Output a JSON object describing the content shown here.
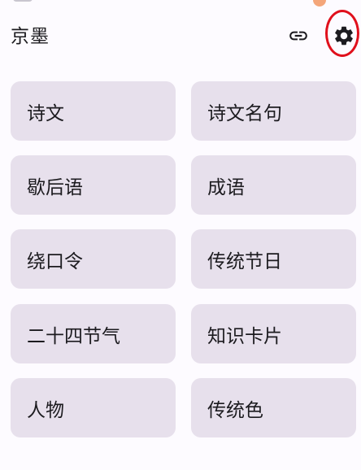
{
  "app_bar": {
    "title": "京墨",
    "link_icon": "link-icon",
    "settings_icon": "gear-icon"
  },
  "colors": {
    "background": "#fdfbff",
    "tile_background": "#e7e0ec",
    "text": "#1c1b1f",
    "highlight": "#e0101c"
  },
  "menu": {
    "items": [
      {
        "label": "诗文"
      },
      {
        "label": "诗文名句"
      },
      {
        "label": "歇后语"
      },
      {
        "label": "成语"
      },
      {
        "label": "绕口令"
      },
      {
        "label": "传统节日"
      },
      {
        "label": "二十四节气"
      },
      {
        "label": "知识卡片"
      },
      {
        "label": "人物"
      },
      {
        "label": "传统色"
      }
    ]
  }
}
